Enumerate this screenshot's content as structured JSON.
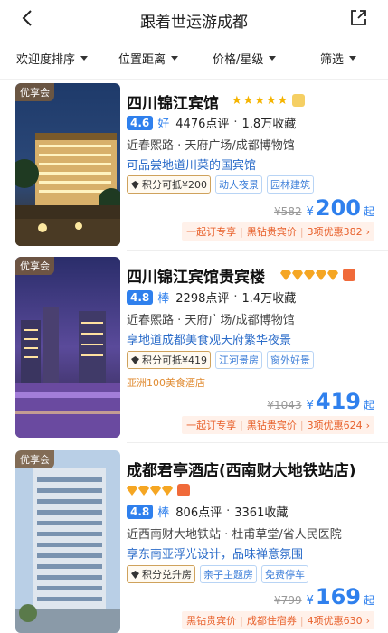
{
  "header": {
    "title": "跟着世运游成都"
  },
  "filters": [
    {
      "label": "欢迎度排序"
    },
    {
      "label": "位置距离"
    },
    {
      "label": "价格/星级"
    },
    {
      "label": "筛选"
    }
  ],
  "hotels": [
    {
      "badge": "优享会",
      "name": "四川锦江宾馆",
      "star_type": "star",
      "star_count": 5,
      "score": "4.6",
      "score_word": "好",
      "reviews": "4476点评",
      "collect": "1.8万收藏",
      "location": "近春熙路 · 天府广场/成都博物馆",
      "blurb": "可品尝地道川菜的国宾馆",
      "points_tag": "积分可抵¥200",
      "tags": [
        "动人夜景",
        "园林建筑"
      ],
      "extra_tag": "",
      "orig_price": "¥582",
      "currency": "¥",
      "price": "200",
      "qi": "起",
      "promo": [
        "一起订专享",
        "黑钻贵宾价",
        "3项优惠382"
      ]
    },
    {
      "badge": "优享会",
      "name": "四川锦江宾馆贵宾楼",
      "star_type": "diamond",
      "star_count": 5,
      "score": "4.8",
      "score_word": "棒",
      "reviews": "2298点评",
      "collect": "1.4万收藏",
      "location": "近春熙路 · 天府广场/成都博物馆",
      "blurb": "享地道成都美食观天府繁华夜景",
      "points_tag": "积分可抵¥419",
      "tags": [
        "江河景房",
        "窗外好景"
      ],
      "extra_tag": "亚洲100美食酒店",
      "orig_price": "¥1043",
      "currency": "¥",
      "price": "419",
      "qi": "起",
      "promo": [
        "一起订专享",
        "黑钻贵宾价",
        "3项优惠624"
      ]
    },
    {
      "badge": "优享会",
      "name": "成都君亭酒店(西南财大地铁站店)",
      "star_type": "diamond",
      "star_count": 4,
      "score": "4.8",
      "score_word": "棒",
      "reviews": "806点评",
      "collect": "3361收藏",
      "location": "近西南财大地铁站 · 杜甫草堂/省人民医院",
      "blurb": "享东南亚浮光设计，品味禅意氛围",
      "points_tag": "积分兑升房",
      "tags": [
        "亲子主题房",
        "免费停车"
      ],
      "extra_tag": "",
      "orig_price": "¥799",
      "currency": "¥",
      "price": "169",
      "qi": "起",
      "promo": [
        "黑钻贵宾价",
        "成都住宿券",
        "4项优惠630"
      ]
    }
  ],
  "colors": {
    "accent_blue": "#2f80ed",
    "promo_orange": "#e8612c",
    "star_gold": "#f5b400"
  }
}
